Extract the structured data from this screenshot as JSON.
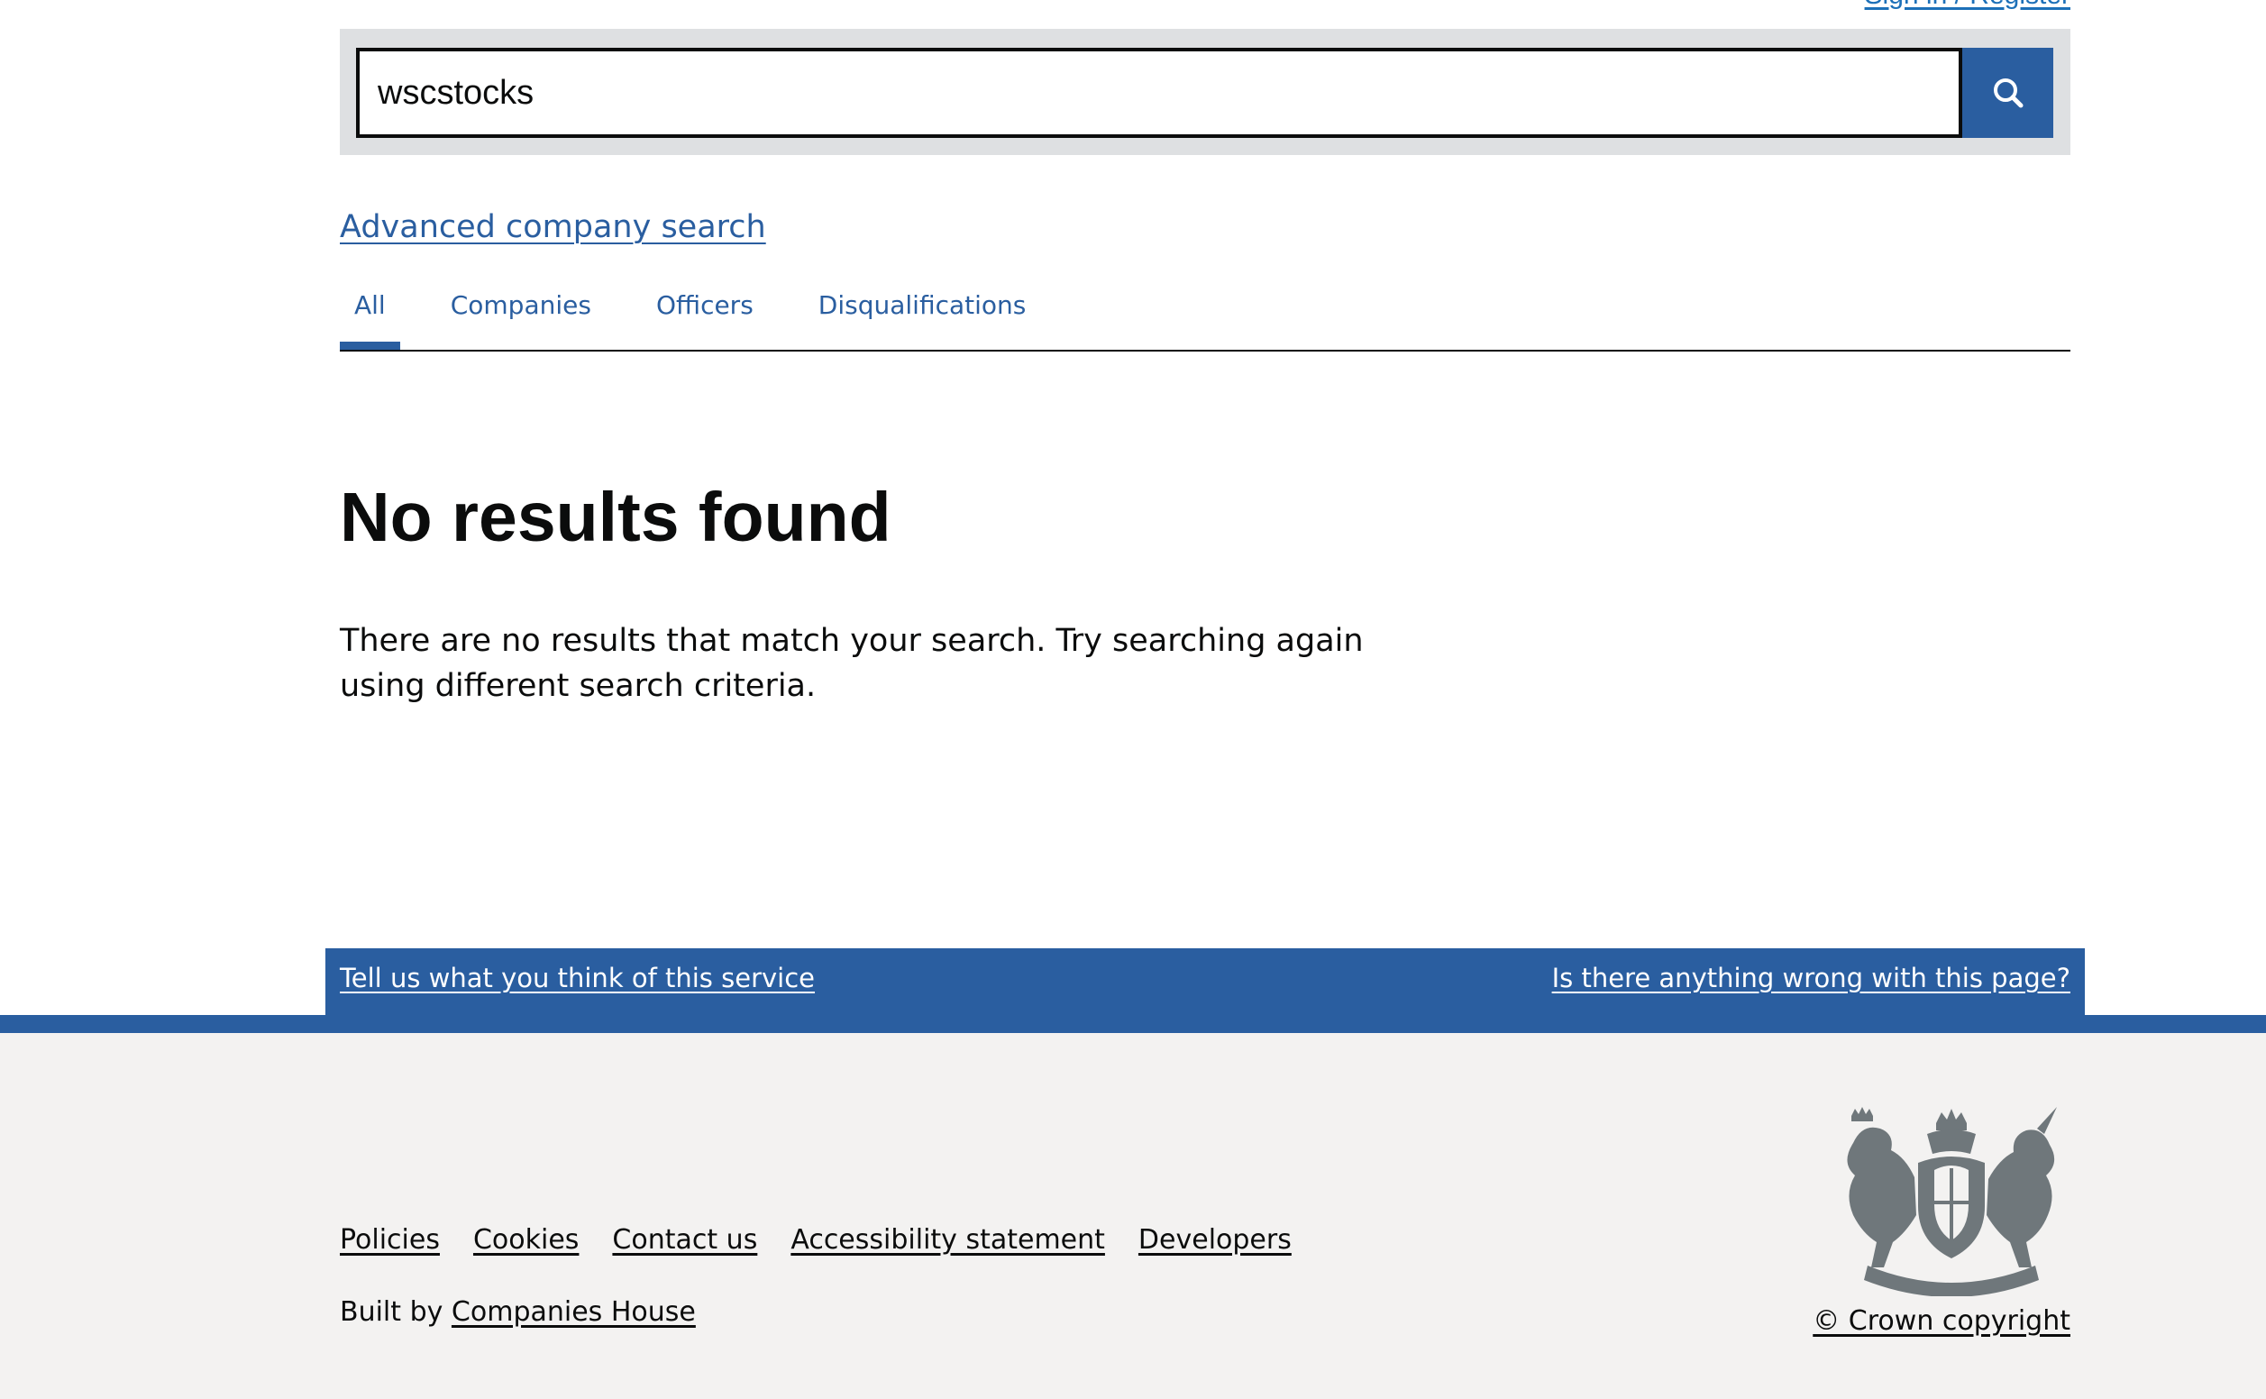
{
  "header": {
    "auth_link": "Sign in / Register"
  },
  "search": {
    "value": "wscstocks",
    "button_icon": "search-icon"
  },
  "advanced_search_link": "Advanced company search",
  "tabs": [
    {
      "label": "All",
      "active": true
    },
    {
      "label": "Companies",
      "active": false
    },
    {
      "label": "Officers",
      "active": false
    },
    {
      "label": "Disqualifications",
      "active": false
    }
  ],
  "results": {
    "heading": "No results found",
    "message": "There are no results that match your search. Try searching again using different search criteria."
  },
  "feedback": {
    "left_link": "Tell us what you think of this service",
    "right_link": "Is there anything wrong with this page?"
  },
  "footer": {
    "links": [
      "Policies",
      "Cookies",
      "Contact us",
      "Accessibility statement",
      "Developers"
    ],
    "built_by_prefix": "Built by",
    "built_by_link": "Companies House",
    "copyright": "© Crown copyright",
    "crest_icon": "royal-coat-of-arms-icon"
  },
  "colors": {
    "brand_blue": "#2a5ea0",
    "text": "#0b0c0c",
    "search_bg": "#dee0e2",
    "footer_bg": "#f3f2f1"
  }
}
